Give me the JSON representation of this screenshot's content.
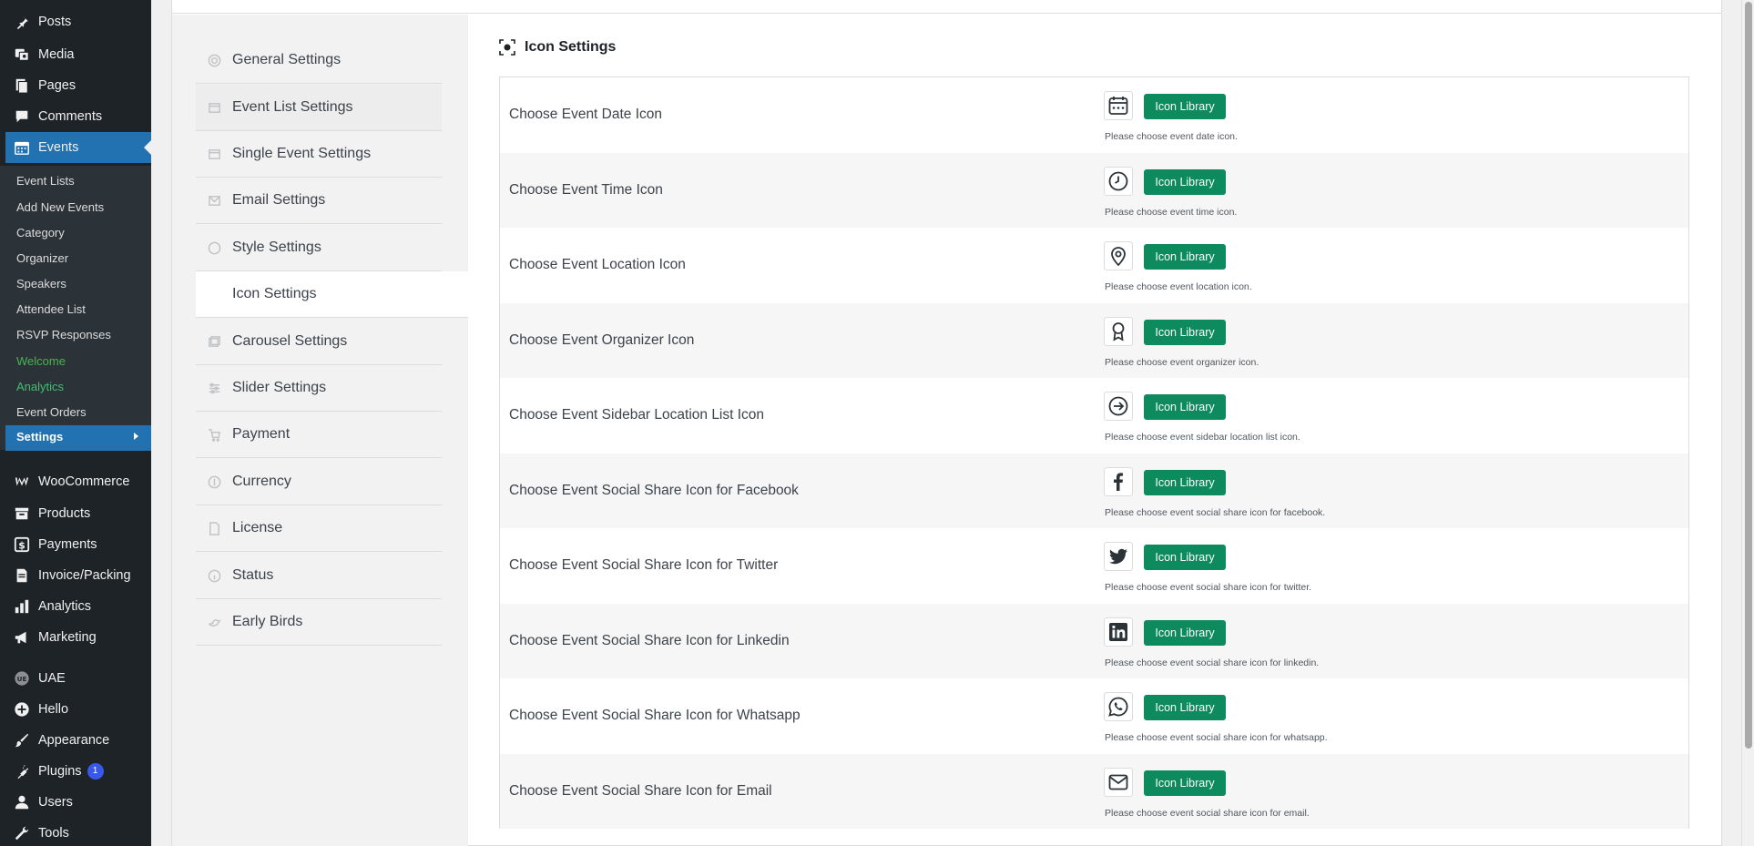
{
  "admin_menu": {
    "top_items": [
      {
        "label": "Posts",
        "icon": "pin-icon"
      },
      {
        "label": "Media",
        "icon": "media-icon"
      },
      {
        "label": "Pages",
        "icon": "pages-icon"
      },
      {
        "label": "Comments",
        "icon": "comment-icon"
      },
      {
        "label": "Events",
        "icon": "calendar-icon"
      }
    ],
    "events_submenu": [
      "Event Lists",
      "Add New Events",
      "Category",
      "Organizer",
      "Speakers",
      "Attendee List",
      "RSVP Responses",
      "Welcome",
      "Analytics",
      "Event Orders"
    ],
    "settings_label": "Settings",
    "bottom_items": [
      {
        "label": "WooCommerce",
        "icon": "woo-icon"
      },
      {
        "label": "Products",
        "icon": "archive-icon"
      },
      {
        "label": "Payments",
        "icon": "dollar-icon"
      },
      {
        "label": "Invoice/Packing",
        "icon": "invoice-icon"
      },
      {
        "label": "Analytics",
        "icon": "bar-chart-icon"
      },
      {
        "label": "Marketing",
        "icon": "megaphone-icon"
      },
      {
        "label": "UAE",
        "icon": "uae-icon"
      },
      {
        "label": "Hello",
        "icon": "plus-circle-icon"
      },
      {
        "label": "Appearance",
        "icon": "brush-icon"
      },
      {
        "label": "Plugins",
        "icon": "plug-icon",
        "badge": "1"
      },
      {
        "label": "Users",
        "icon": "user-icon"
      },
      {
        "label": "Tools",
        "icon": "wrench-icon"
      }
    ]
  },
  "settings_tabs": [
    "General Settings",
    "Event List Settings",
    "Single Event Settings",
    "Email Settings",
    "Style Settings",
    "Icon Settings",
    "Carousel Settings",
    "Slider Settings",
    "Payment",
    "Currency",
    "License",
    "Status",
    "Early Birds"
  ],
  "panel": {
    "title": "Icon Settings",
    "button_label": "Icon Library",
    "rows": [
      {
        "label": "Choose Event Date Icon",
        "desc": "Please choose event date icon.",
        "icon": "calendar-icon"
      },
      {
        "label": "Choose Event Time Icon",
        "desc": "Please choose event time icon.",
        "icon": "clock-icon"
      },
      {
        "label": "Choose Event Location Icon",
        "desc": "Please choose event location icon.",
        "icon": "location-pin-icon"
      },
      {
        "label": "Choose Event Organizer Icon",
        "desc": "Please choose event organizer icon.",
        "icon": "award-icon"
      },
      {
        "label": "Choose Event Sidebar Location List Icon",
        "desc": "Please choose event sidebar location list icon.",
        "icon": "arrow-circle-right-icon"
      },
      {
        "label": "Choose Event Social Share Icon for Facebook",
        "desc": "Please choose event social share icon for facebook.",
        "icon": "facebook-icon"
      },
      {
        "label": "Choose Event Social Share Icon for Twitter",
        "desc": "Please choose event social share icon for twitter.",
        "icon": "twitter-icon"
      },
      {
        "label": "Choose Event Social Share Icon for Linkedin",
        "desc": "Please choose event social share icon for linkedin.",
        "icon": "linkedin-icon"
      },
      {
        "label": "Choose Event Social Share Icon for Whatsapp",
        "desc": "Please choose event social share icon for whatsapp.",
        "icon": "whatsapp-icon"
      },
      {
        "label": "Choose Event Social Share Icon for Email",
        "desc": "Please choose event social share icon for email.",
        "icon": "envelope-icon"
      }
    ]
  },
  "colors": {
    "admin_bg": "#1d2327",
    "admin_accent": "#2271b1",
    "button_green": "#0e8a5f",
    "welcome_green": "#46b450"
  }
}
